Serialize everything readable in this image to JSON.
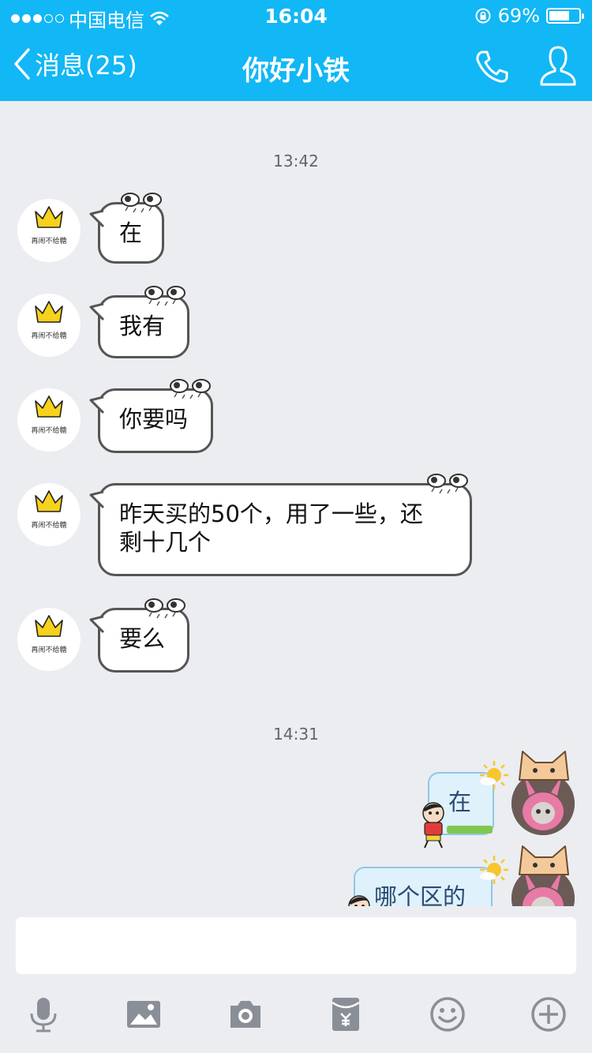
{
  "status_bar": {
    "carrier": "中国电信",
    "time": "16:04",
    "battery_text": "69%",
    "battery_level": 0.69
  },
  "nav": {
    "back_label": "消息(25)",
    "title": "你好小铁"
  },
  "chat": {
    "timestamps": [
      "13:42",
      "14:31"
    ],
    "avatar_text": "再闹不给糖",
    "incoming": [
      {
        "text": "在"
      },
      {
        "text": "我有"
      },
      {
        "text": "你要吗"
      },
      {
        "line1": "昨天买的50个，用了一些，还",
        "line2": "剩十几个"
      },
      {
        "text": "要么"
      }
    ],
    "outgoing": [
      {
        "text": "在"
      },
      {
        "text": "哪个区的"
      }
    ]
  },
  "input": {
    "placeholder": ""
  },
  "toolbar": {
    "icons": [
      "microphone-icon",
      "image-icon",
      "camera-icon",
      "red-packet-icon",
      "emoji-icon",
      "plus-icon"
    ]
  },
  "colors": {
    "accent": "#12b7f5",
    "background": "#ebedf1",
    "bubble_border": "#555555",
    "icon_gray": "#8a8f97"
  }
}
